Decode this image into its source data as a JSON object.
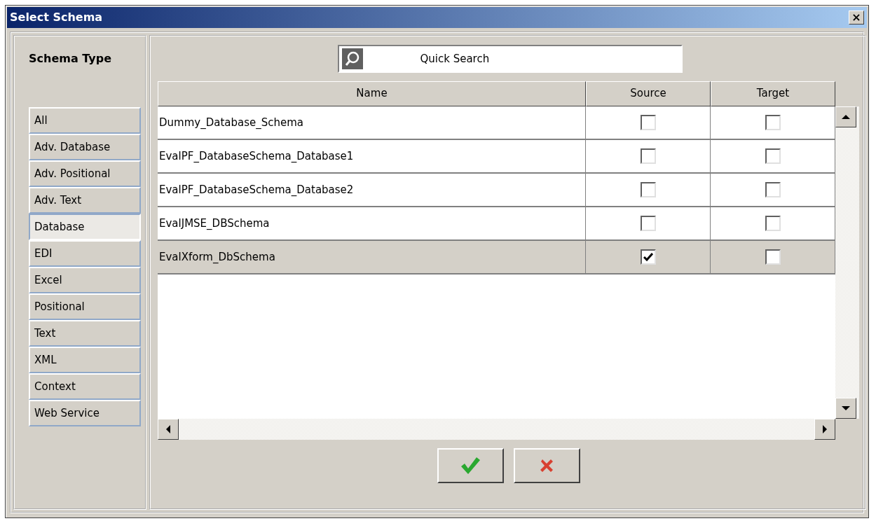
{
  "window": {
    "title": "Select Schema",
    "close": "×"
  },
  "sidebar": {
    "title": "Schema Type",
    "items": [
      {
        "label": "All",
        "selected": false
      },
      {
        "label": "Adv. Database",
        "selected": false
      },
      {
        "label": "Adv. Positional",
        "selected": false
      },
      {
        "label": "Adv. Text",
        "selected": false
      },
      {
        "label": "Database",
        "selected": true
      },
      {
        "label": "EDI",
        "selected": false
      },
      {
        "label": "Excel",
        "selected": false
      },
      {
        "label": "Positional",
        "selected": false
      },
      {
        "label": "Text",
        "selected": false
      },
      {
        "label": "XML",
        "selected": false
      },
      {
        "label": "Context",
        "selected": false
      },
      {
        "label": "Web Service",
        "selected": false
      }
    ]
  },
  "search": {
    "value": "Quick Search"
  },
  "table": {
    "columns": [
      "Name",
      "Source",
      "Target"
    ],
    "rows": [
      {
        "name": "Dummy_Database_Schema",
        "source": false,
        "target": false,
        "selected": false
      },
      {
        "name": "EvalPF_DatabaseSchema_Database1",
        "source": false,
        "target": false,
        "selected": false
      },
      {
        "name": "EvalPF_DatabaseSchema_Database2",
        "source": false,
        "target": false,
        "selected": false
      },
      {
        "name": "EvalJMSE_DBSchema",
        "source": false,
        "target": false,
        "selected": false
      },
      {
        "name": "EvalXform_DbSchema",
        "source": true,
        "target": false,
        "selected": true
      }
    ]
  },
  "buttons": [
    {
      "kind": "ok"
    },
    {
      "kind": "cancel"
    }
  ]
}
